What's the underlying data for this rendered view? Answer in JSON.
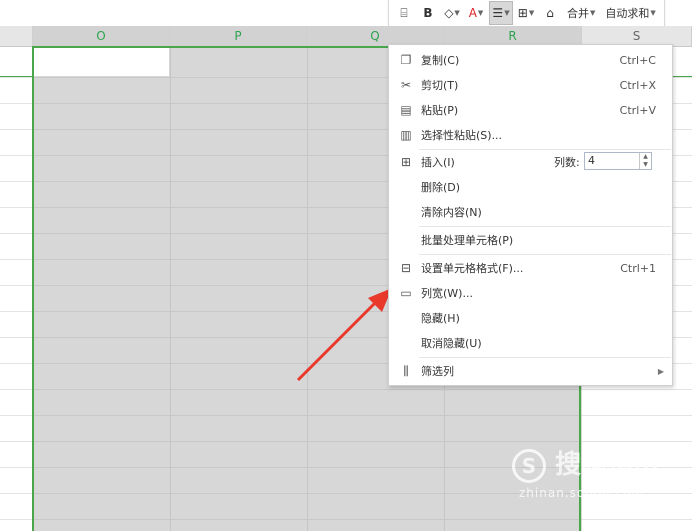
{
  "toolbar": {
    "buttons": [
      {
        "name": "wrap-icon",
        "glyph": "⌸"
      },
      {
        "name": "bold-icon",
        "glyph": "B"
      },
      {
        "name": "fill-color-icon",
        "glyph": "◇"
      },
      {
        "name": "font-color-icon",
        "glyph": "A"
      },
      {
        "name": "align-center-icon",
        "glyph": "☰"
      },
      {
        "name": "borders-icon",
        "glyph": "⊞"
      },
      {
        "name": "format-painter-icon",
        "glyph": "⌂"
      }
    ],
    "merge_label": "合并",
    "autosum_label": "自动求和"
  },
  "columns": [
    "O",
    "P",
    "Q",
    "R",
    "S"
  ],
  "context_menu": {
    "copy": {
      "label": "复制(C)",
      "shortcut": "Ctrl+C"
    },
    "cut": {
      "label": "剪切(T)",
      "shortcut": "Ctrl+X"
    },
    "paste": {
      "label": "粘贴(P)",
      "shortcut": "Ctrl+V"
    },
    "paste_special": {
      "label": "选择性粘贴(S)..."
    },
    "insert": {
      "label": "插入(I)",
      "cols_label": "列数:",
      "cols_value": "4"
    },
    "delete": {
      "label": "删除(D)"
    },
    "clear": {
      "label": "清除内容(N)"
    },
    "batch": {
      "label": "批量处理单元格(P)"
    },
    "format_cells": {
      "label": "设置单元格格式(F)...",
      "shortcut": "Ctrl+1"
    },
    "col_width": {
      "label": "列宽(W)..."
    },
    "hide": {
      "label": "隐藏(H)"
    },
    "unhide": {
      "label": "取消隐藏(U)"
    },
    "filter": {
      "label": "筛选列"
    }
  },
  "watermark": {
    "text": "搜狗指南",
    "logo": "S",
    "url": "zhinan.sogou.com"
  },
  "colors": {
    "selection_border": "#4aa64a",
    "selection_fill": "#d7d7d7",
    "arrow": "#e8392a"
  }
}
